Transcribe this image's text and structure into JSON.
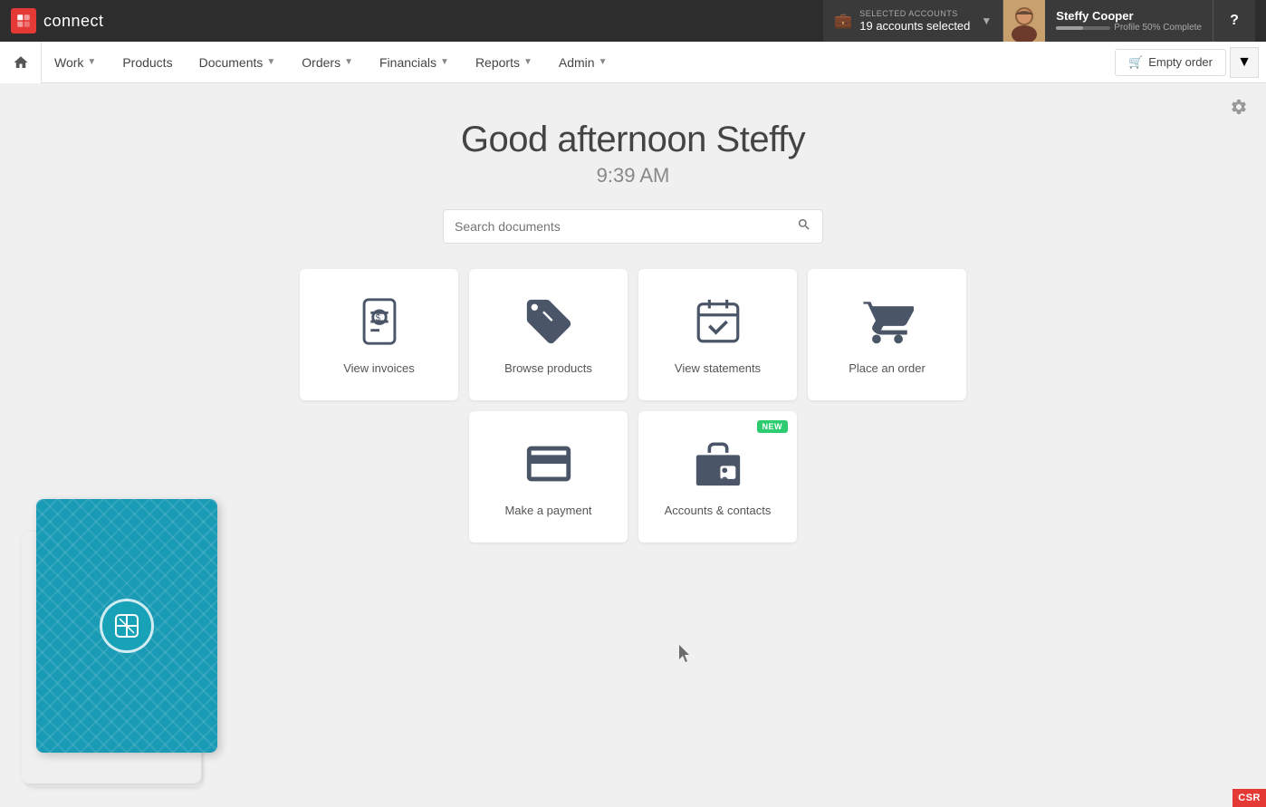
{
  "topbar": {
    "logo_text": "connect",
    "accounts_label": "SELECTED ACCOUNTS",
    "accounts_value": "19 accounts selected",
    "user_name": "Steffy Cooper",
    "profile_text": "Profile 50% Complete",
    "profile_percent": 50,
    "help_label": "?"
  },
  "navbar": {
    "home_label": "Home",
    "items": [
      {
        "label": "Work",
        "has_dropdown": true
      },
      {
        "label": "Products",
        "has_dropdown": false
      },
      {
        "label": "Documents",
        "has_dropdown": true
      },
      {
        "label": "Orders",
        "has_dropdown": true
      },
      {
        "label": "Financials",
        "has_dropdown": true
      },
      {
        "label": "Reports",
        "has_dropdown": true
      },
      {
        "label": "Admin",
        "has_dropdown": true
      }
    ],
    "empty_order_label": "Empty order"
  },
  "main": {
    "greeting": "Good afternoon Steffy",
    "time": "9:39 AM",
    "search_placeholder": "Search documents"
  },
  "cards": {
    "row1": [
      {
        "id": "view-invoices",
        "label": "View invoices",
        "icon": "invoice",
        "new": false
      },
      {
        "id": "browse-products",
        "label": "Browse products",
        "icon": "tag",
        "new": false
      },
      {
        "id": "view-statements",
        "label": "View statements",
        "icon": "calendar-check",
        "new": false
      },
      {
        "id": "place-order",
        "label": "Place an order",
        "icon": "cart",
        "new": false
      }
    ],
    "row2": [
      {
        "id": "make-payment",
        "label": "Make a payment",
        "icon": "card",
        "new": false
      },
      {
        "id": "accounts-contacts",
        "label": "Accounts & contacts",
        "icon": "briefcase-id",
        "new": true
      }
    ]
  },
  "csr_badge": "CSR"
}
